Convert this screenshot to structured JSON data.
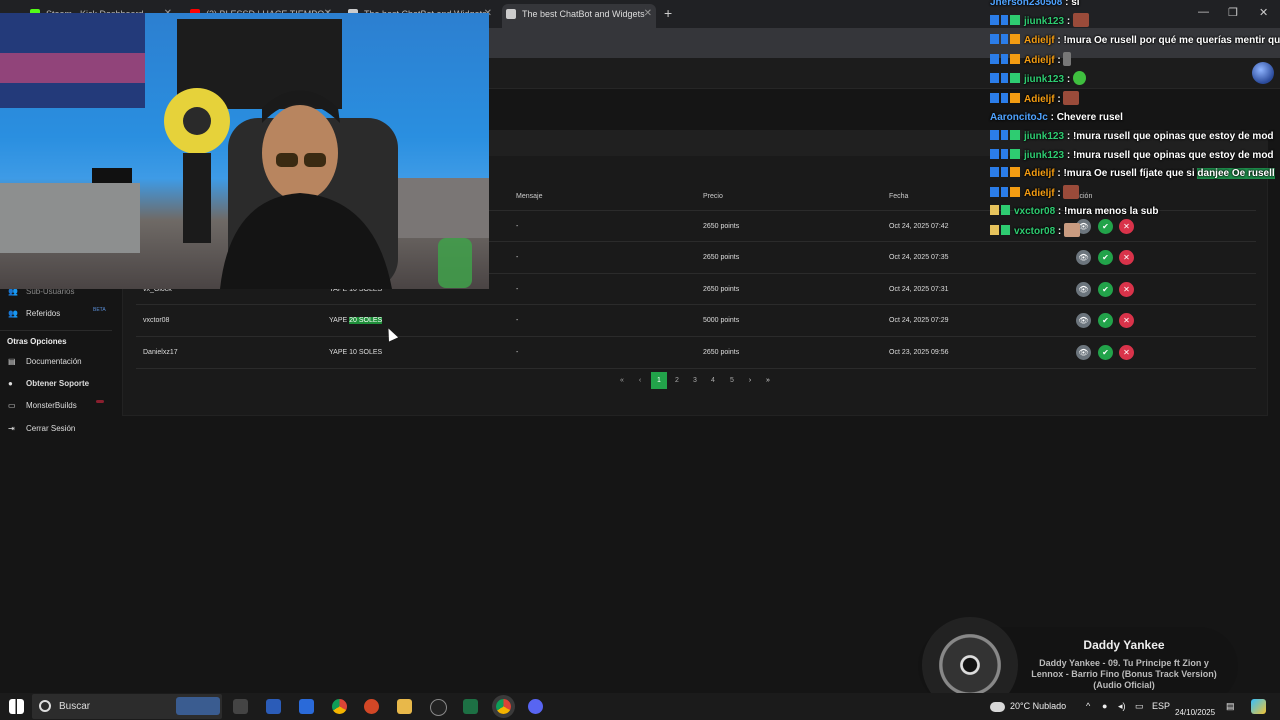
{
  "browser": {
    "tabs": [
      {
        "label": "Steam - Kick Dashboard",
        "icon": "kick-icon",
        "color": "#53fc18"
      },
      {
        "label": "(2) BLESSD | HACE TIEMPO |",
        "icon": "youtube-icon",
        "color": "#ff0000"
      },
      {
        "label": "The best ChatBot and Widgets",
        "icon": "botrix-icon",
        "color": "#cccccc"
      },
      {
        "label": "The best ChatBot and Widgets",
        "icon": "botrix-icon",
        "color": "#cccccc"
      }
    ],
    "new_tab": "+",
    "window_controls": [
      "—",
      "❐",
      "✕"
    ]
  },
  "sidebar": {
    "items": [
      {
        "label": "Sub-Usuarios",
        "icon": "users-icon"
      },
      {
        "label": "Referidos",
        "icon": "users-icon",
        "badge": "BETA"
      }
    ],
    "section_title": "Otras Opciones",
    "other_items": [
      {
        "label": "Documentación",
        "icon": "book-icon"
      },
      {
        "label": "Obtener Soporte",
        "icon": "support-icon"
      },
      {
        "label": "MonsterBuilds",
        "icon": "monitor-icon"
      },
      {
        "label": "Cerrar Sesión",
        "icon": "logout-icon"
      }
    ]
  },
  "table": {
    "headers": {
      "mensaje": "Mensaje",
      "precio": "Precio",
      "fecha": "Fecha",
      "accion": "cción"
    },
    "rows": [
      {
        "user": "",
        "item": "",
        "mensaje": "-",
        "precio": "2650 points",
        "fecha": "Oct 24, 2025 07:42"
      },
      {
        "user": "",
        "item": "",
        "mensaje": "-",
        "precio": "2650 points",
        "fecha": "Oct 24, 2025 07:35"
      },
      {
        "user": "vx_Glock",
        "item": "YAPE 10 SOLES",
        "mensaje": "-",
        "precio": "2650 points",
        "fecha": "Oct 24, 2025 07:31"
      },
      {
        "user": "vxctor08",
        "item_pre": "YAPE ",
        "item_sel": "20 SOLES",
        "mensaje": "-",
        "precio": "5000 points",
        "fecha": "Oct 24, 2025 07:29"
      },
      {
        "user": "Danielxz17",
        "item": "YAPE 10 SOLES",
        "mensaje": "-",
        "precio": "2650 points",
        "fecha": "Oct 23, 2025 09:56"
      }
    ],
    "actions": {
      "view": "👁",
      "approve": "✔",
      "reject": "✕"
    }
  },
  "pagination": {
    "first": "«",
    "prev": "‹",
    "pages": [
      "1",
      "2",
      "3",
      "4",
      "5"
    ],
    "current": "1",
    "next": "›",
    "last": "»"
  },
  "chat": {
    "lines": [
      {
        "user": "Jherson230508",
        "user_color": "#4fa3ff",
        "msg": "si",
        "badges": ""
      },
      {
        "user": "jiunk123",
        "user_color": "#2ecc71",
        "msg": "",
        "badges": "green",
        "emote": true
      },
      {
        "user": "Adieljf",
        "user_color": "#f39c12",
        "msg": "!mura Oe rusell por qué me querías mentir que y",
        "badges": "orange"
      },
      {
        "user": "Adieljf",
        "user_color": "#f39c12",
        "msg": "",
        "badges": "orange",
        "emote": true
      },
      {
        "user": "jiunk123",
        "user_color": "#2ecc71",
        "msg": "",
        "badges": "green",
        "emote": true
      },
      {
        "user": "Adieljf",
        "user_color": "#f39c12",
        "msg": "",
        "badges": "orange",
        "emote": true
      },
      {
        "user": "AaroncitoJc",
        "user_color": "#4fa3ff",
        "msg": "Chevere rusel",
        "badges": ""
      },
      {
        "user": "jiunk123",
        "user_color": "#2ecc71",
        "msg": "!mura rusell que opinas que estoy de mod",
        "badges": "green"
      },
      {
        "user": "jiunk123",
        "user_color": "#2ecc71",
        "msg": "!mura rusell que opinas que estoy de mod",
        "badges": "green"
      },
      {
        "user": "Adieljf",
        "user_color": "#f39c12",
        "msg": "!mura Oe rusell fíjate que si ",
        "msg_hl": "danjee Oe rusell",
        "badges": "orange"
      },
      {
        "user": "Adieljf",
        "user_color": "#f39c12",
        "msg": "",
        "badges": "orange",
        "emote": true
      },
      {
        "user": "vxctor08",
        "user_color": "#2ecc71",
        "msg": "!mura menos la sub",
        "badges": "gold"
      },
      {
        "user": "vxctor08",
        "user_color": "#2ecc71",
        "msg": "",
        "badges": "gold",
        "emote": true
      }
    ],
    "separator": ":"
  },
  "music": {
    "artist": "Daddy Yankee",
    "song": "Daddy Yankee - 09. Tu Principe ft Zion y Lennox - Barrio Fino (Bonus Track Version) (Audio Oficial)"
  },
  "taskbar": {
    "search_placeholder": "Buscar",
    "weather": "20°C  Nublado",
    "lang": "ESP",
    "date": "24/10/2025"
  },
  "colors": {
    "accent": "#22a34a",
    "danger": "#d9334a",
    "neutral": "#6c757d"
  }
}
